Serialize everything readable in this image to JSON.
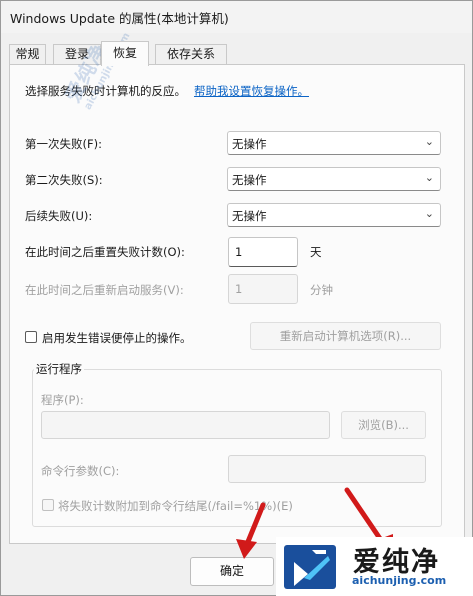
{
  "window": {
    "title": "Windows Update 的属性(本地计算机)"
  },
  "tabs": [
    {
      "label": "常规",
      "active": false
    },
    {
      "label": "登录",
      "active": false
    },
    {
      "label": "恢复",
      "active": true
    },
    {
      "label": "依存关系",
      "active": false
    }
  ],
  "recovery": {
    "intro": "选择服务失败时计算机的反应。",
    "help_link": "帮助我设置恢复操作。",
    "first_failure": {
      "label": "第一次失败(F):",
      "value": "无操作"
    },
    "second_failure": {
      "label": "第二次失败(S):",
      "value": "无操作"
    },
    "subsequent_failures": {
      "label": "后续失败(U):",
      "value": "无操作"
    },
    "reset_count": {
      "label": "在此时间之后重置失败计数(O):",
      "value": "1",
      "unit": "天"
    },
    "restart_service": {
      "label": "在此时间之后重新启动服务(V):",
      "value": "1",
      "unit": "分钟"
    },
    "enable_actions": {
      "label": "启用发生错误便停止的操作。",
      "checked": false
    },
    "restart_computer_button": "重新启动计算机选项(R)...",
    "run_program": {
      "group_title": "运行程序",
      "program_label": "程序(P):",
      "program_value": "",
      "browse_button": "浏览(B)...",
      "params_label": "命令行参数(C):",
      "params_value": "",
      "append_fail_count": {
        "label": "将失败计数附加到命令行结尾(/fail=%1%)(E)",
        "checked": false
      }
    }
  },
  "footer": {
    "ok_button": "确定"
  },
  "watermark": {
    "name": "爱纯净",
    "url": "aichunjing.com",
    "vertical": "爱纯净",
    "vertical_url": "aichunjing.com"
  },
  "colors": {
    "link": "#0b63c5",
    "arrow": "#d11a1a",
    "disabled_text": "#a0a0a0"
  }
}
